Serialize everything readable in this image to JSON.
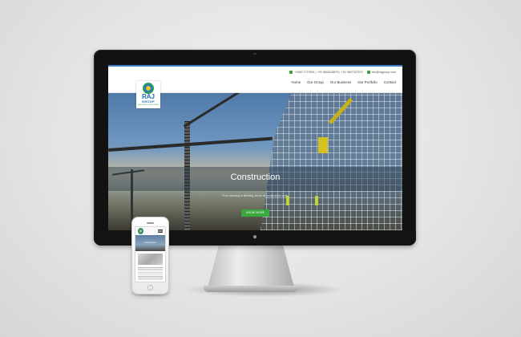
{
  "site": {
    "contact": {
      "phone_numbers": "+0487 2737891 | +91 9846038676 | +91 9847337570",
      "email": "info@rajgroup.com"
    },
    "nav": [
      "Home",
      "Our Group",
      "Our Business",
      "Our Portfolio",
      "Contact"
    ],
    "logo": {
      "name": "RAJ",
      "sub": "GROUP",
      "tagline": "BUILDERS & DEVELOPERS"
    },
    "hero": {
      "title": "Construction",
      "subtitle": "From planning to finishing, we do all construction work.",
      "button_label": "KNOW MORE"
    }
  },
  "mobile": {
    "hero_title": "Construction"
  },
  "colors": {
    "accent_green": "#39a83d",
    "brand_blue": "#1c6fb8",
    "bezel": "#121212",
    "background": "#e4e4e4"
  },
  "icons": {
    "phone": "phone-icon",
    "email": "email-icon",
    "menu": "hamburger-menu-icon",
    "device_logo": "apple-logo-icon"
  }
}
